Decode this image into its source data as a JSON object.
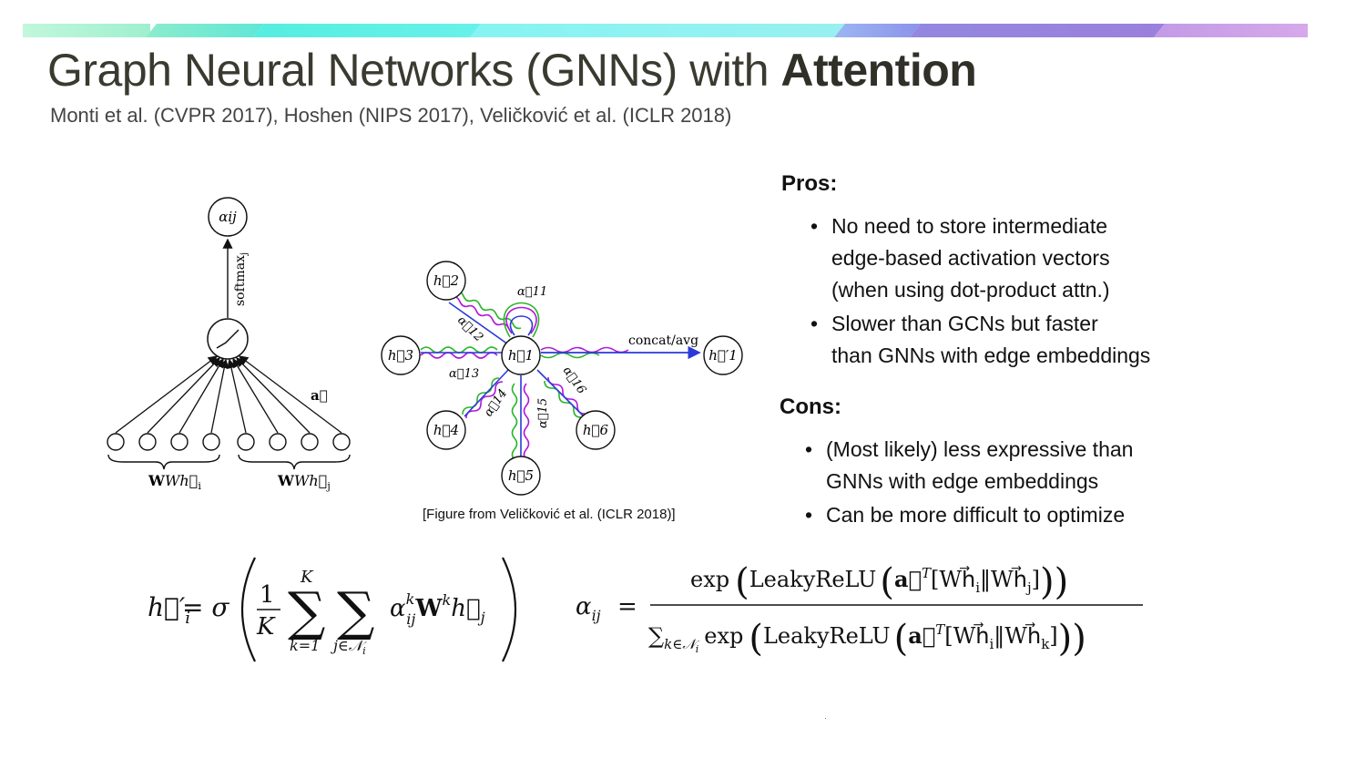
{
  "colors": {
    "bar": [
      "#b6f5d6",
      "#7ee7c8",
      "#55eedd",
      "#7ff3f0",
      "#8fa4ef",
      "#9a8bdc",
      "#c8a0e6"
    ],
    "edge_green": "#2ab52a",
    "edge_purple": "#b018d8",
    "edge_blue": "#2a3ad8"
  },
  "slide": {
    "title_regular": "Graph Neural Networks (GNNs) with ",
    "title_bold": "Attention",
    "subtitle": "Monti et al. (CVPR 2017), Hoshen (NIPS 2017), Veličković et al. (ICLR 2018)"
  },
  "figure": {
    "caption": "[Figure from Veličković et al. (ICLR 2018)]",
    "left": {
      "alpha_node": "αij",
      "softmax_label": "softmax",
      "softmax_sub": "j",
      "a_label": "a⃗",
      "wh_i": "Wh⃗",
      "wh_i_sub": "i",
      "wh_j": "Wh⃗",
      "wh_j_sub": "j"
    },
    "right": {
      "center": "h⃗1",
      "nodes": [
        "h⃗2",
        "h⃗3",
        "h⃗4",
        "h⃗5",
        "h⃗6"
      ],
      "output": "h⃗′1",
      "concat_label": "concat/avg",
      "alphas": [
        "α⃗11",
        "α⃗12",
        "α⃗13",
        "α⃗14",
        "α⃗15",
        "α⃗16"
      ]
    }
  },
  "pros": {
    "heading": "Pros:",
    "items": [
      [
        "No need to store intermediate",
        "edge-based activation vectors",
        "(when using dot-product attn.)"
      ],
      [
        "Slower than GCNs but faster",
        "than GNNs with edge embeddings"
      ]
    ]
  },
  "cons": {
    "heading": "Cons:",
    "items": [
      [
        "(Most likely) less expressive than",
        "GNNs with edge embeddings"
      ],
      [
        "Can be more difficult to optimize"
      ]
    ]
  },
  "equations": {
    "left": {
      "lhs": "h⃗′",
      "lhs_sub": "i",
      "eq": "= σ",
      "frac_num": "1",
      "frac_den": "K",
      "sum1_top": "K",
      "sum1_bottom": "k=1",
      "sum2_bottom": "j∈𝒩",
      "sum2_bottom_sub": "i",
      "term": "α",
      "term_sup": "k",
      "term_sub": "ij",
      "term_rest": "W",
      "term_rest_sup": "k",
      "term_h": "h⃗",
      "term_h_sub": "j"
    },
    "right": {
      "lhs": "α",
      "lhs_sub": "ij",
      "eq": "=",
      "num_exp": "exp",
      "num_leaky": "LeakyReLU",
      "num_a": "a⃗",
      "num_T": "T",
      "num_bracket": "[Wh⃗",
      "num_i": "i",
      "num_mid": "‖Wh⃗",
      "num_j": "j",
      "num_close": "]",
      "den_sum": "∑",
      "den_sum_sub": "k∈𝒩",
      "den_sum_sub_i": "i",
      "den_exp": "exp",
      "den_leaky": "LeakyReLU",
      "den_a": "a⃗",
      "den_T": "T",
      "den_bracket": "[Wh⃗",
      "den_i": "i",
      "den_mid": "‖Wh⃗",
      "den_k": "k",
      "den_close": "]"
    }
  }
}
